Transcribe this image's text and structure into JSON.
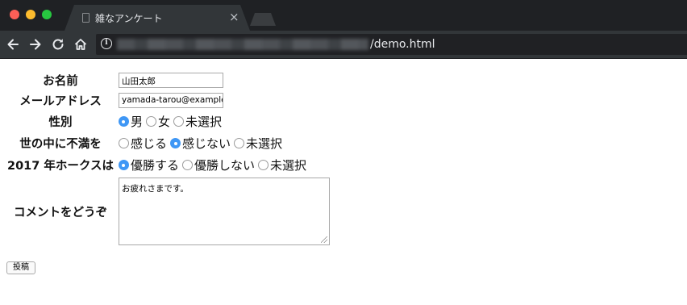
{
  "browser": {
    "tab_title": "雑なアンケート",
    "tab_close": "×",
    "url_suffix": "/demo.html"
  },
  "form": {
    "name": {
      "label": "お名前",
      "value": "山田太郎"
    },
    "email": {
      "label": "メールアドレス",
      "value": "yamada-tarou@example"
    },
    "gender": {
      "label": "性別",
      "options": [
        "男",
        "女",
        "未選択"
      ],
      "selected": "男"
    },
    "dissatisfaction": {
      "label": "世の中に不満を",
      "options": [
        "感じる",
        "感じない",
        "未選択"
      ],
      "selected": "感じない"
    },
    "hawks": {
      "label": "2017 年ホークスは",
      "options": [
        "優勝する",
        "優勝しない",
        "未選択"
      ],
      "selected": "優勝する"
    },
    "comment": {
      "label": "コメントをどうぞ",
      "value": "お疲れさまです。"
    },
    "submit_label": "投稿"
  },
  "icons": {
    "back": "arrow-left-icon",
    "forward": "arrow-right-icon",
    "reload": "reload-icon",
    "home": "home-icon",
    "info": "info-icon"
  },
  "colors": {
    "radio_checked": "#3f97f5",
    "chrome_dark": "#1f2124",
    "toolbar": "#323639"
  }
}
